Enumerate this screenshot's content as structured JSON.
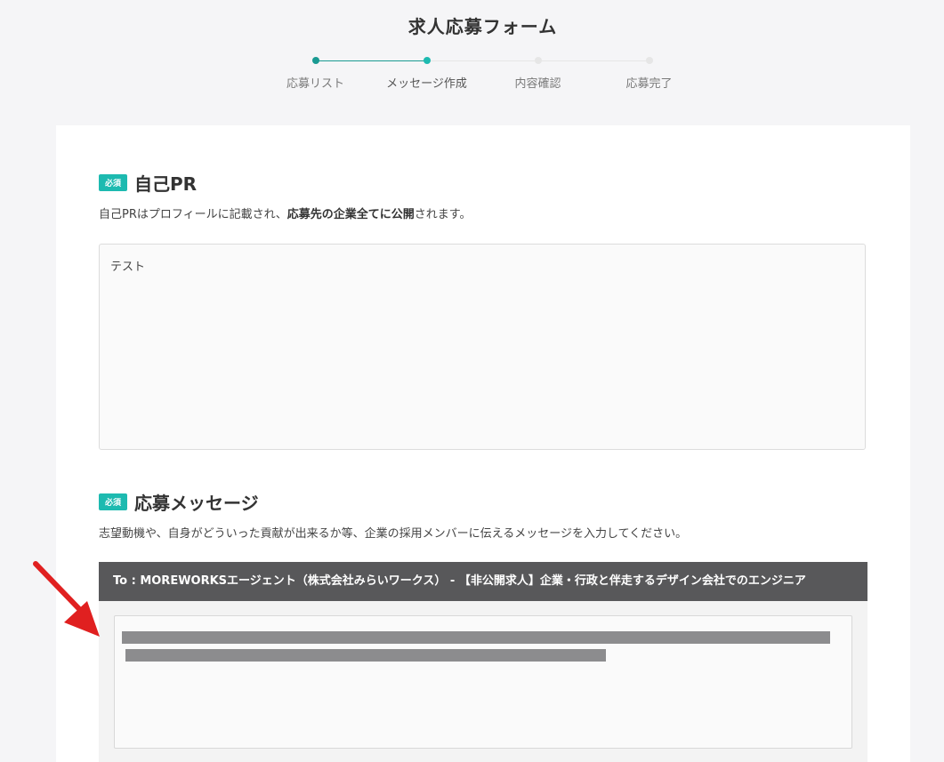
{
  "page": {
    "title": "求人応募フォーム"
  },
  "stepper": {
    "steps": [
      {
        "label": "応募リスト",
        "state": "done"
      },
      {
        "label": "メッセージ作成",
        "state": "current"
      },
      {
        "label": "内容確認",
        "state": "todo"
      },
      {
        "label": "応募完了",
        "state": "todo"
      }
    ],
    "colors": {
      "active": "#1a9a92",
      "inactive": "#e6e6e6"
    }
  },
  "self_pr": {
    "badge": "必須",
    "title": "自己PR",
    "desc_prefix": "自己PRはプロフィールに記載され、",
    "desc_bold": "応募先の企業全てに公開",
    "desc_suffix": "されます。",
    "value": "テスト"
  },
  "message": {
    "badge": "必須",
    "title": "応募メッセージ",
    "desc": "志望動機や、自身がどういった貢献が出来るか等、企業の採用メンバーに伝えるメッセージを入力してください。",
    "to_header": "To : MOREWORKSエージェント（株式会社みらいワークス） - 【非公開求人】企業・行政と伴走するデザイン会社でのエンジニア",
    "value_redacted": true
  },
  "annotation": {
    "arrow_color": "#e02020"
  },
  "colors": {
    "accent": "#1dbab0",
    "header_bg": "#58585a"
  }
}
